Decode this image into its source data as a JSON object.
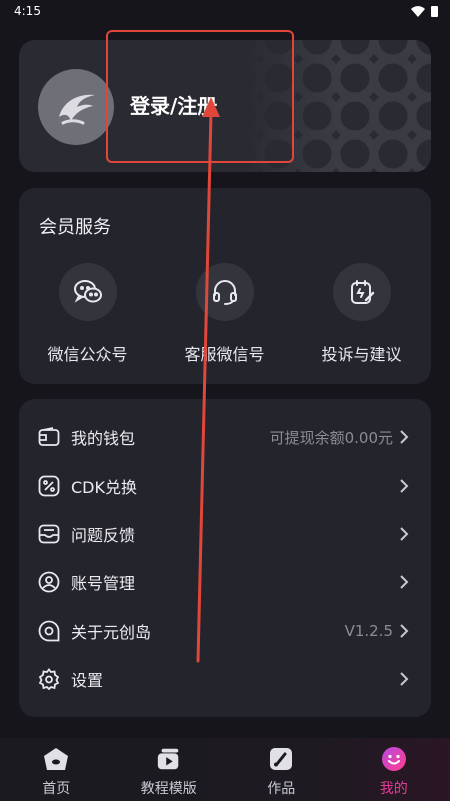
{
  "status_bar": {
    "time": "4:15",
    "icons": [
      "wifi-icon",
      "battery-icon"
    ]
  },
  "profile": {
    "login_label": "登录/注册",
    "avatar_icon": "logo-icon"
  },
  "member_services": {
    "title": "会员服务",
    "items": [
      {
        "label": "微信公众号",
        "icon": "wechat-icon"
      },
      {
        "label": "客服微信号",
        "icon": "headset-icon"
      },
      {
        "label": "投诉与建议",
        "icon": "feedback-edit-icon"
      }
    ]
  },
  "menu": {
    "items": [
      {
        "label": "我的钱包",
        "value": "可提现余额0.00元",
        "icon": "wallet-icon"
      },
      {
        "label": "CDK兑换",
        "value": "",
        "icon": "percent-coupon-icon"
      },
      {
        "label": "问题反馈",
        "value": "",
        "icon": "inbox-icon"
      },
      {
        "label": "账号管理",
        "value": "",
        "icon": "user-circle-icon"
      },
      {
        "label": "关于元创岛",
        "value": "V1.2.5",
        "icon": "about-icon"
      },
      {
        "label": "设置",
        "value": "",
        "icon": "gear-icon"
      }
    ]
  },
  "tabs": [
    {
      "label": "首页",
      "icon": "home-icon",
      "active": false
    },
    {
      "label": "教程模版",
      "icon": "video-template-icon",
      "active": false
    },
    {
      "label": "作品",
      "icon": "works-icon",
      "active": false
    },
    {
      "label": "我的",
      "icon": "smile-icon",
      "active": true
    }
  ],
  "colors": {
    "background": "#15151b",
    "card": "#24242c",
    "accent": "#e43d9a",
    "annotation": "#e0473a"
  }
}
